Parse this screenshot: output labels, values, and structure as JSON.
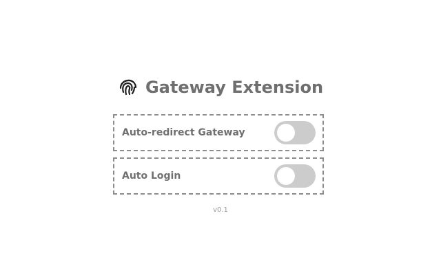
{
  "header": {
    "logo_icon": "fingerprint-icon",
    "title": "Gateway Extension"
  },
  "settings": [
    {
      "label": "Auto-redirect Gateway",
      "enabled": false
    },
    {
      "label": "Auto Login",
      "enabled": false
    }
  ],
  "footer": {
    "version": "v0.1"
  },
  "colors": {
    "text": "#6f6f6f",
    "border": "#8c8c8c",
    "toggle_off": "#cccccc",
    "toggle_knob": "#ffffff",
    "muted": "#9a9a9a"
  }
}
